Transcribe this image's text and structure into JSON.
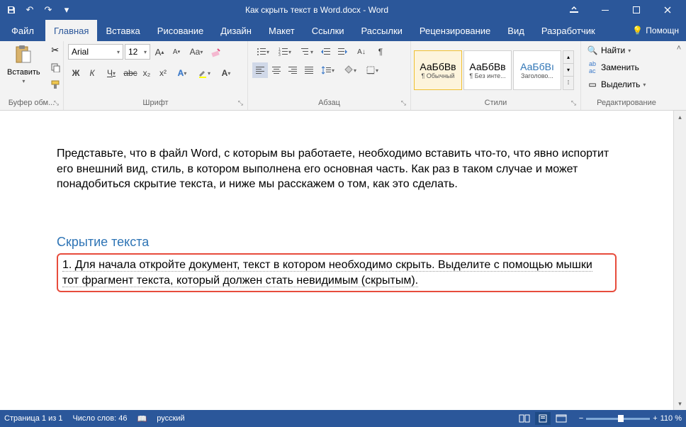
{
  "titlebar": {
    "title": "Как скрыть текст в Word.docx - Word"
  },
  "tabs": {
    "file": "Файл",
    "home": "Главная",
    "insert": "Вставка",
    "draw": "Рисование",
    "design": "Дизайн",
    "layout": "Макет",
    "references": "Ссылки",
    "mailings": "Рассылки",
    "review": "Рецензирование",
    "view": "Вид",
    "developer": "Разработчик",
    "help": "Помощн"
  },
  "ribbon": {
    "clipboard": {
      "label": "Буфер обм...",
      "paste": "Вставить"
    },
    "font": {
      "label": "Шрифт",
      "name": "Arial",
      "size": "12",
      "bold": "Ж",
      "italic": "К",
      "underline": "Ч",
      "strike": "abc",
      "sub": "x₂",
      "sup": "x²"
    },
    "paragraph": {
      "label": "Абзац"
    },
    "styles": {
      "label": "Стили",
      "items": [
        {
          "preview": "АаБбВв",
          "name": "¶ Обычный"
        },
        {
          "preview": "АаБбВв",
          "name": "¶ Без инте..."
        },
        {
          "preview": "АаБбВı",
          "name": "Заголово..."
        }
      ]
    },
    "editing": {
      "label": "Редактирование",
      "find": "Найти",
      "replace": "Заменить",
      "select": "Выделить"
    }
  },
  "document": {
    "para1": "Представьте, что в файл Word, с которым вы работаете, необходимо вставить что-то, что явно испортит его внешний вид, стиль, в котором выполнена его основная часть. Как раз в таком случае и может понадобиться скрытие текста, и ниже мы расскажем о том, как это сделать.",
    "heading": "Скрытие текста",
    "boxed": "1. Для начала откройте документ, текст в котором необходимо скрыть. Выделите с помощью мышки тот фрагмент текста, который должен стать невидимым (скрытым)."
  },
  "statusbar": {
    "page": "Страница 1 из 1",
    "words": "Число слов: 46",
    "lang": "русский",
    "zoom": "110 %"
  }
}
